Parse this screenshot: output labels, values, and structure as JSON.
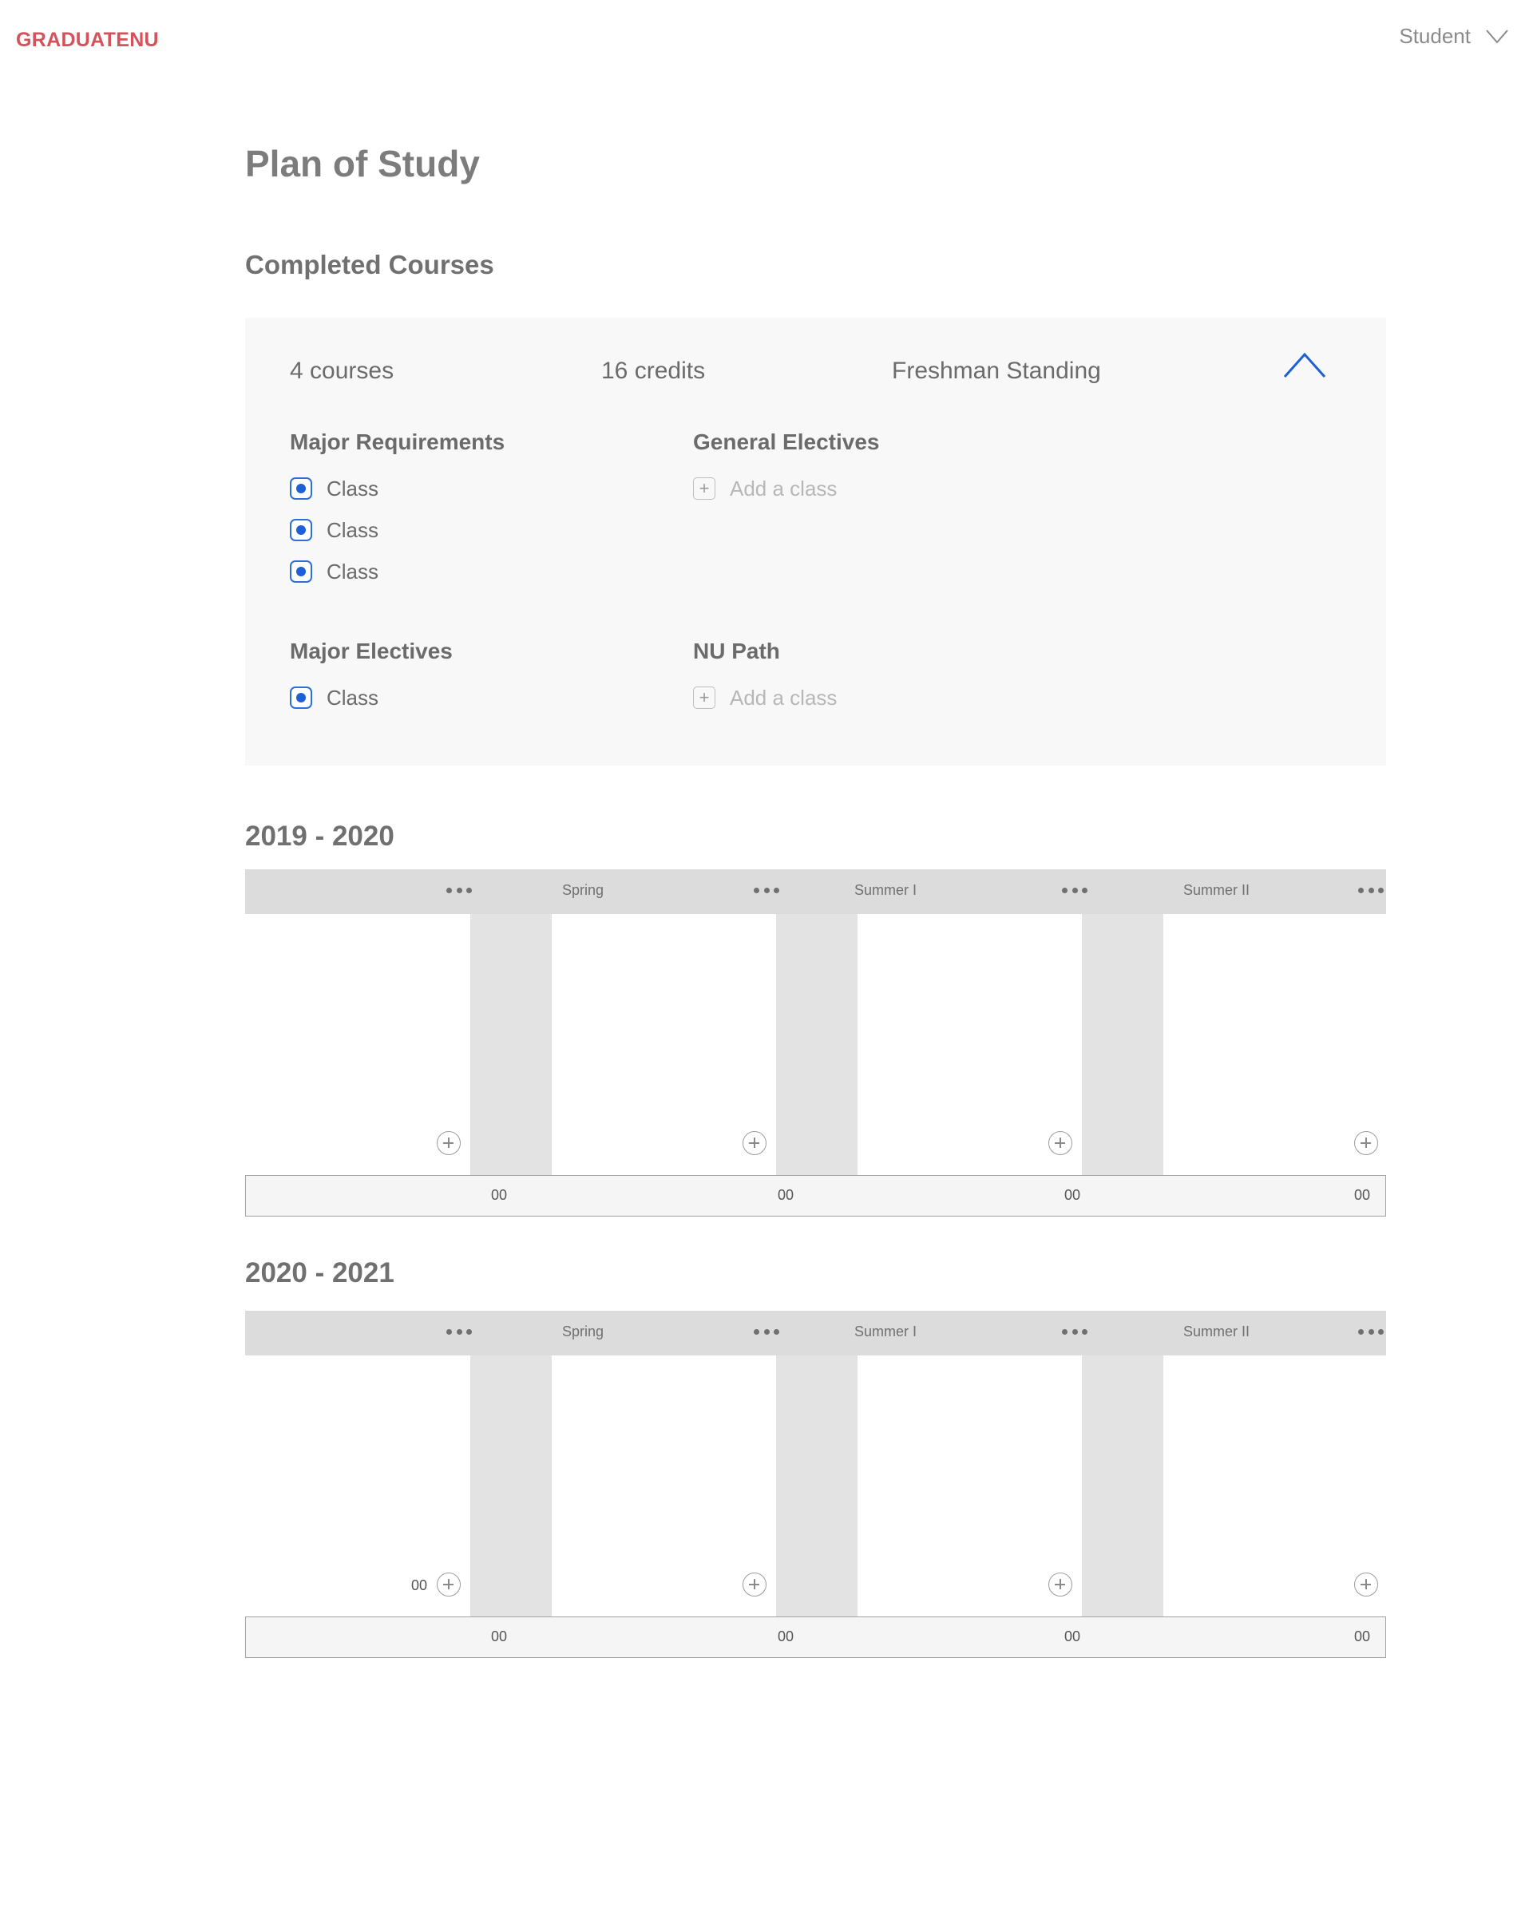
{
  "header": {
    "brand": "GRADUATENU",
    "user_label": "Student",
    "user_menu_icon": "chevron-down-icon"
  },
  "page_title": "Plan of Study",
  "completed": {
    "section_title": "Completed Courses",
    "stats": {
      "courses": "4 courses",
      "credits": "16 credits",
      "standing": "Freshman Standing"
    },
    "collapse_icon": "chevron-up-icon",
    "accent_color": "#1d5fd6",
    "groups": {
      "major_requirements": {
        "title": "Major Requirements",
        "classes": [
          "Class",
          "Class",
          "Class"
        ]
      },
      "general_electives": {
        "title": "General Electives",
        "add_label": "Add a class"
      },
      "major_electives": {
        "title": "Major Electives",
        "classes": [
          "Class"
        ]
      },
      "nu_path": {
        "title": "NU Path",
        "add_label": "Add a class"
      }
    }
  },
  "years": [
    {
      "title": "2019 - 2020",
      "terms": [
        "Spring",
        "Summer I",
        "Summer II"
      ],
      "totals": [
        "00",
        "00",
        "00",
        "00"
      ]
    },
    {
      "title": "2020 - 2021",
      "terms": [
        "Spring",
        "Summer I",
        "Summer II"
      ],
      "inline_count": "00",
      "totals": [
        "00",
        "00",
        "00",
        "00"
      ]
    }
  ],
  "brand_color": "#d6525b"
}
